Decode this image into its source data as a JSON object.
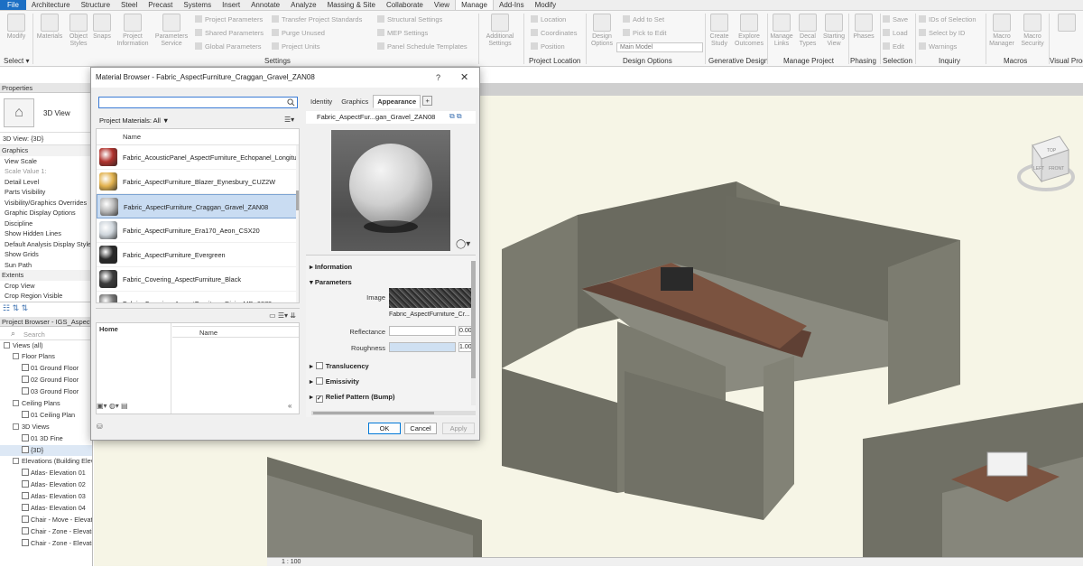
{
  "ribbon": {
    "tabs": [
      "File",
      "Architecture",
      "Structure",
      "Steel",
      "Precast",
      "Systems",
      "Insert",
      "Annotate",
      "Analyze",
      "Massing & Site",
      "Collaborate",
      "View",
      "Manage",
      "Add-Ins",
      "Modify"
    ],
    "active_tab": "Manage",
    "buttons": {
      "modify": "Modify",
      "materials": "Materials",
      "object_styles": "Object Styles",
      "snaps": "Snaps",
      "project_information": "Project Information",
      "parameters_service": "Parameters Service",
      "additional_settings": "Additional Settings",
      "design_options": "Design Options",
      "create_study": "Create Study",
      "explore_outcomes": "Explore Outcomes",
      "manage_links": "Manage Links",
      "decal_types": "Decal Types",
      "starting_view": "Starting View",
      "phases": "Phases",
      "macro_manager": "Macro Manager",
      "macro_security": "Macro Security"
    },
    "small": {
      "project_parameters": "Project Parameters",
      "shared_parameters": "Shared Parameters",
      "global_parameters": "Global Parameters",
      "transfer_standards": "Transfer Project Standards",
      "purge_unused": "Purge Unused",
      "project_units": "Project Units",
      "structural_settings": "Structural Settings",
      "mep_settings": "MEP Settings",
      "panel_schedule_templates": "Panel Schedule Templates",
      "location": "Location",
      "coordinates": "Coordinates",
      "position": "Position",
      "add_to_set": "Add to Set",
      "pick_to_edit": "Pick to Edit",
      "main_model": "Main Model",
      "save": "Save",
      "load": "Load",
      "edit": "Edit",
      "ids_of_selection": "IDs of Selection",
      "select_by_id": "Select by ID",
      "warnings": "Warnings"
    },
    "panels": {
      "select": "Select ▾",
      "settings": "Settings",
      "project_location": "Project Location",
      "design_options": "Design Options",
      "generative_design": "Generative Design",
      "manage_project": "Manage Project",
      "phasing": "Phasing",
      "selection": "Selection",
      "inquiry": "Inquiry",
      "macros": "Macros",
      "visual_prog": "Visual Prog"
    }
  },
  "properties": {
    "title": "Properties",
    "type_name": "3D View",
    "view_selector": "3D View: {3D}",
    "rows": [
      {
        "label": "Graphics",
        "kind": "sec"
      },
      {
        "label": "View Scale",
        "kind": "row"
      },
      {
        "label": "Scale Value    1:",
        "kind": "dim"
      },
      {
        "label": "Detail Level",
        "kind": "row"
      },
      {
        "label": "Parts Visibility",
        "kind": "row"
      },
      {
        "label": "Visibility/Graphics Overrides",
        "kind": "row"
      },
      {
        "label": "Graphic Display Options",
        "kind": "row"
      },
      {
        "label": "Discipline",
        "kind": "row"
      },
      {
        "label": "Show Hidden Lines",
        "kind": "row"
      },
      {
        "label": "Default Analysis Display Style",
        "kind": "row"
      },
      {
        "label": "Show Grids",
        "kind": "row"
      },
      {
        "label": "Sun Path",
        "kind": "row"
      },
      {
        "label": "Extents",
        "kind": "sec"
      },
      {
        "label": "Crop View",
        "kind": "row"
      },
      {
        "label": "Crop Region Visible",
        "kind": "row"
      }
    ]
  },
  "project_browser": {
    "title": "Project Browser - IGS_Aspect",
    "search_placeholder": "Search",
    "items": [
      {
        "label": "Views (all)",
        "indent": 0,
        "kind": "toggle"
      },
      {
        "label": "Floor Plans",
        "indent": 1,
        "kind": "toggle"
      },
      {
        "label": "01 Ground Floor",
        "indent": 2,
        "kind": "view"
      },
      {
        "label": "02 Ground Floor",
        "indent": 2,
        "kind": "view"
      },
      {
        "label": "03 Ground Floor",
        "indent": 2,
        "kind": "view"
      },
      {
        "label": "Ceiling Plans",
        "indent": 1,
        "kind": "toggle"
      },
      {
        "label": "01 Ceiling Plan",
        "indent": 2,
        "kind": "view"
      },
      {
        "label": "3D Views",
        "indent": 1,
        "kind": "toggle"
      },
      {
        "label": "01 3D Fine",
        "indent": 2,
        "kind": "view"
      },
      {
        "label": "{3D}",
        "indent": 2,
        "kind": "view"
      },
      {
        "label": "Elevations (Building Elevation)",
        "indent": 1,
        "kind": "toggle"
      },
      {
        "label": "Atlas- Elevation 01",
        "indent": 2,
        "kind": "view"
      },
      {
        "label": "Atlas- Elevation 02",
        "indent": 2,
        "kind": "view"
      },
      {
        "label": "Atlas- Elevation 03",
        "indent": 2,
        "kind": "view"
      },
      {
        "label": "Atlas- Elevation 04",
        "indent": 2,
        "kind": "view"
      },
      {
        "label": "Chair - Move - Elevation",
        "indent": 2,
        "kind": "view"
      },
      {
        "label": "Chair - Zone - Elevation 1",
        "indent": 2,
        "kind": "view"
      },
      {
        "label": "Chair - Zone - Elevation 2",
        "indent": 2,
        "kind": "view"
      }
    ]
  },
  "viewcube": {
    "top": "TOP",
    "left": "LEFT",
    "front": "FRONT"
  },
  "statusbar": {
    "scale": "1 : 100"
  },
  "material_browser": {
    "title": "Material Browser - Fabric_AspectFurniture_Craggan_Gravel_ZAN08",
    "help": "?",
    "close": "✕",
    "search_value": "",
    "project_materials": "Project Materials: All",
    "column_name": "Name",
    "materials": [
      {
        "name": "Fabric_AcousticPanel_AspectFurniture_Echopanel_Longitude",
        "color": "#b0332e",
        "selected": false
      },
      {
        "name": "Fabric_AspectFurniture_Blazer_Eynesbury_CUZ2W",
        "color": "#e2b24e",
        "selected": false
      },
      {
        "name": "Fabric_AspectFurniture_Craggan_Gravel_ZAN08",
        "color": "#b9b9b9",
        "selected": true
      },
      {
        "name": "Fabric_AspectFurniture_Era170_Aeon_CSX20",
        "color": "#cfd6dc",
        "selected": false
      },
      {
        "name": "Fabric_AspectFurniture_Evergreen",
        "color": "#2a2a2a",
        "selected": false
      },
      {
        "name": "Fabric_Covering_AspectFurniture_Black",
        "color": "#3c3c3c",
        "selected": false
      },
      {
        "name": "Fabric_Covering_AspectFurniture_DivinaMD_0873",
        "color": "#777777",
        "selected": false
      }
    ],
    "library": {
      "home": "Home",
      "column_name": "Name"
    },
    "tabs": [
      "Identity",
      "Graphics",
      "Appearance"
    ],
    "active_tab": "Appearance",
    "asset_name": "Fabric_AspectFur...gan_Gravel_ZAN08",
    "sections": {
      "information": "Information",
      "parameters": "Parameters",
      "translucency": "Translucency",
      "emissivity": "Emissivity",
      "relief": "Relief Pattern (Bump)"
    },
    "params": {
      "image_label": "Image",
      "image_name": "Fabric_AspectFurniture_Cr...",
      "reflectance_label": "Reflectance",
      "reflectance_value": "0.00",
      "roughness_label": "Roughness",
      "roughness_value": "1.00"
    },
    "buttons": {
      "ok": "OK",
      "cancel": "Cancel",
      "apply": "Apply"
    }
  }
}
